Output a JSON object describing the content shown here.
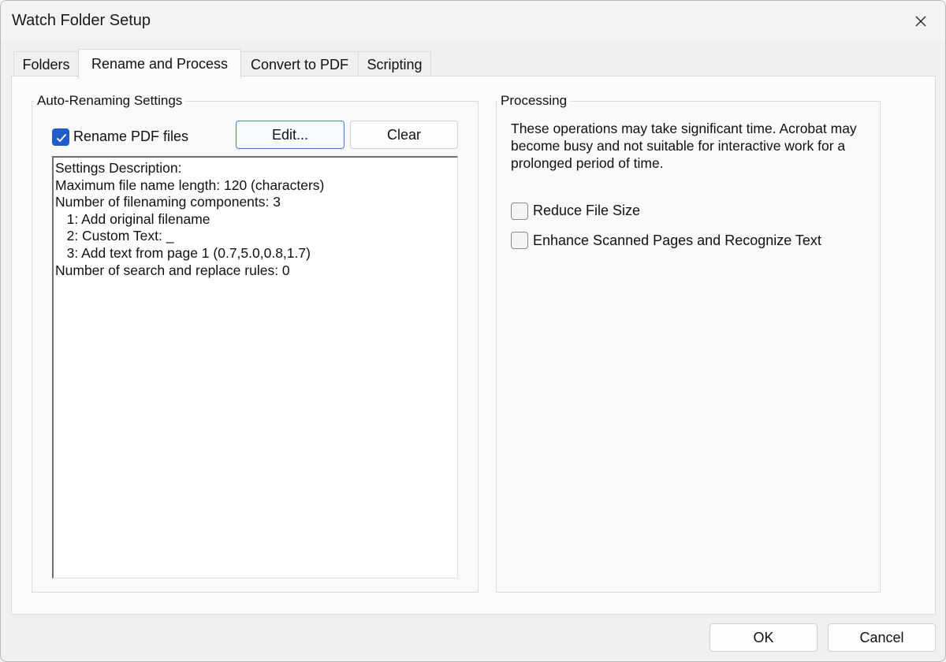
{
  "window": {
    "title": "Watch Folder Setup"
  },
  "tabs": [
    {
      "label": "Folders"
    },
    {
      "label": "Rename and Process"
    },
    {
      "label": "Convert to PDF"
    },
    {
      "label": "Scripting"
    }
  ],
  "auto_renaming": {
    "group_label": "Auto-Renaming Settings",
    "rename_checkbox_label": "Rename PDF files",
    "rename_checked": true,
    "edit_label": "Edit...",
    "clear_label": "Clear",
    "description_lines": [
      "Settings Description:",
      "Maximum file name length: 120 (characters)",
      "Number of filenaming components: 3",
      "   1: Add original filename",
      "   2: Custom Text: _",
      "   3: Add text from page 1 (0.7,5.0,0.8,1.7)",
      "Number of search and replace rules: 0"
    ]
  },
  "processing": {
    "group_label": "Processing",
    "info_text": "These operations may take significant time. Acrobat may become busy and not suitable for interactive work for a prolonged period of time.",
    "reduce_file_size_label": "Reduce File Size",
    "reduce_file_size_checked": false,
    "enhance_label": "Enhance Scanned Pages and Recognize Text",
    "enhance_checked": false
  },
  "footer": {
    "ok_label": "OK",
    "cancel_label": "Cancel"
  },
  "colors": {
    "accent": "#1f5ec8"
  }
}
